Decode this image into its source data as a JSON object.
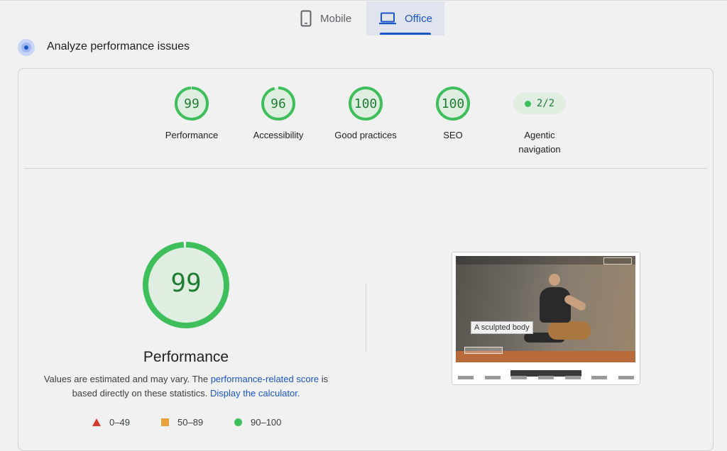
{
  "tabs": [
    {
      "label": "Mobile",
      "icon": "phone-icon",
      "selected": false
    },
    {
      "label": "Office",
      "icon": "laptop-icon",
      "selected": true
    }
  ],
  "header": {
    "title": "Analyze performance issues"
  },
  "gauges": [
    {
      "score": "99",
      "label": "Performance",
      "fraction": 0.99
    },
    {
      "score": "96",
      "label": "Accessibility",
      "fraction": 0.96
    },
    {
      "score": "100",
      "label": "Good practices",
      "fraction": 1.0
    },
    {
      "score": "100",
      "label": "SEO",
      "fraction": 1.0
    }
  ],
  "agentic": {
    "value": "2/2",
    "label_line1": "Agentic",
    "label_line2": "navigation"
  },
  "main": {
    "score": "99",
    "fraction": 0.99,
    "title": "Performance",
    "desc_part1": "Values are estimated and may vary. The",
    "link1": "performance-related score",
    "desc_part2": "is based directly on these statistics.",
    "link2": "Display the calculator."
  },
  "legend": [
    {
      "range": "0–49",
      "shape": "triangle",
      "color": "#d63b2f"
    },
    {
      "range": "50–89",
      "shape": "square",
      "color": "#e8a03b"
    },
    {
      "range": "90–100",
      "shape": "circle",
      "color": "#3fbf5b"
    }
  ],
  "screenshot": {
    "tooltip": "A sculpted body"
  },
  "colors": {
    "accent": "#1a56c5",
    "pass": "#3fbf5b",
    "pass_text": "#1e7d32"
  }
}
